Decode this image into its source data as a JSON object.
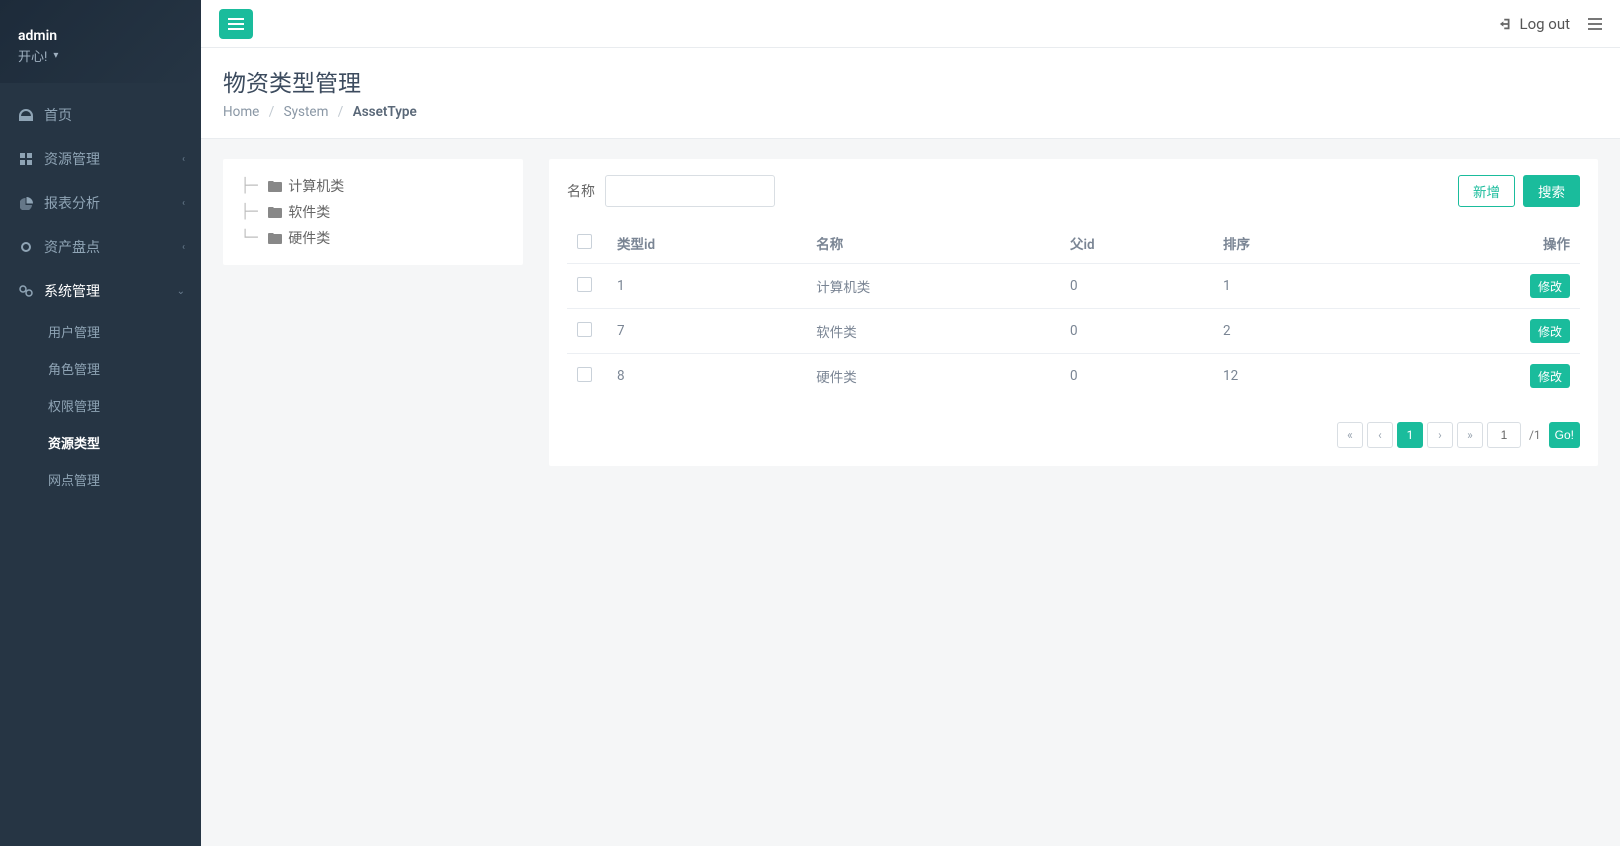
{
  "user": {
    "name": "admin",
    "status": "开心!"
  },
  "topbar": {
    "logout": "Log out"
  },
  "sidebar": {
    "items": [
      {
        "label": "首页",
        "icon": "dashboard"
      },
      {
        "label": "资源管理",
        "icon": "grid",
        "chev": true
      },
      {
        "label": "报表分析",
        "icon": "pie",
        "chev": true
      },
      {
        "label": "资产盘点",
        "icon": "dot",
        "chev": true
      },
      {
        "label": "系统管理",
        "icon": "cogs",
        "chev": true,
        "open": true
      }
    ],
    "sub": [
      {
        "label": "用户管理"
      },
      {
        "label": "角色管理"
      },
      {
        "label": "权限管理"
      },
      {
        "label": "资源类型",
        "active": true
      },
      {
        "label": "网点管理"
      }
    ]
  },
  "page": {
    "title": "物资类型管理",
    "breadcrumb": {
      "home": "Home",
      "mid": "System",
      "last": "AssetType"
    }
  },
  "tree": {
    "nodes": [
      {
        "label": "计算机类"
      },
      {
        "label": "软件类"
      },
      {
        "label": "硬件类"
      }
    ]
  },
  "filter": {
    "name_label": "名称",
    "add_label": "新增",
    "search_label": "搜索"
  },
  "table": {
    "headers": {
      "type_id": "类型id",
      "name": "名称",
      "parent_id": "父id",
      "sort": "排序",
      "op": "操作"
    },
    "op_label": "修改",
    "rows": [
      {
        "type_id": "1",
        "name": "计算机类",
        "parent_id": "0",
        "sort": "1"
      },
      {
        "type_id": "7",
        "name": "软件类",
        "parent_id": "0",
        "sort": "2"
      },
      {
        "type_id": "8",
        "name": "硬件类",
        "parent_id": "0",
        "sort": "12"
      }
    ]
  },
  "pager": {
    "current": "1",
    "input": "1",
    "total_suffix": "/1",
    "go": "Go!"
  }
}
